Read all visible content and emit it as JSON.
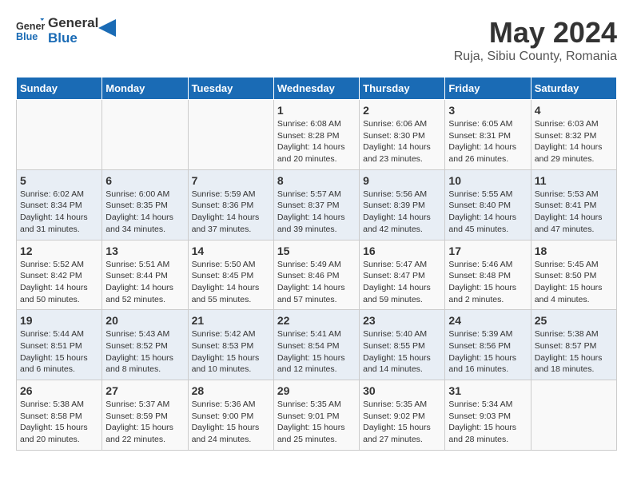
{
  "header": {
    "logo_line1": "General",
    "logo_line2": "Blue",
    "month": "May 2024",
    "location": "Ruja, Sibiu County, Romania"
  },
  "weekdays": [
    "Sunday",
    "Monday",
    "Tuesday",
    "Wednesday",
    "Thursday",
    "Friday",
    "Saturday"
  ],
  "weeks": [
    [
      {
        "day": "",
        "info": ""
      },
      {
        "day": "",
        "info": ""
      },
      {
        "day": "",
        "info": ""
      },
      {
        "day": "1",
        "info": "Sunrise: 6:08 AM\nSunset: 8:28 PM\nDaylight: 14 hours\nand 20 minutes."
      },
      {
        "day": "2",
        "info": "Sunrise: 6:06 AM\nSunset: 8:30 PM\nDaylight: 14 hours\nand 23 minutes."
      },
      {
        "day": "3",
        "info": "Sunrise: 6:05 AM\nSunset: 8:31 PM\nDaylight: 14 hours\nand 26 minutes."
      },
      {
        "day": "4",
        "info": "Sunrise: 6:03 AM\nSunset: 8:32 PM\nDaylight: 14 hours\nand 29 minutes."
      }
    ],
    [
      {
        "day": "5",
        "info": "Sunrise: 6:02 AM\nSunset: 8:34 PM\nDaylight: 14 hours\nand 31 minutes."
      },
      {
        "day": "6",
        "info": "Sunrise: 6:00 AM\nSunset: 8:35 PM\nDaylight: 14 hours\nand 34 minutes."
      },
      {
        "day": "7",
        "info": "Sunrise: 5:59 AM\nSunset: 8:36 PM\nDaylight: 14 hours\nand 37 minutes."
      },
      {
        "day": "8",
        "info": "Sunrise: 5:57 AM\nSunset: 8:37 PM\nDaylight: 14 hours\nand 39 minutes."
      },
      {
        "day": "9",
        "info": "Sunrise: 5:56 AM\nSunset: 8:39 PM\nDaylight: 14 hours\nand 42 minutes."
      },
      {
        "day": "10",
        "info": "Sunrise: 5:55 AM\nSunset: 8:40 PM\nDaylight: 14 hours\nand 45 minutes."
      },
      {
        "day": "11",
        "info": "Sunrise: 5:53 AM\nSunset: 8:41 PM\nDaylight: 14 hours\nand 47 minutes."
      }
    ],
    [
      {
        "day": "12",
        "info": "Sunrise: 5:52 AM\nSunset: 8:42 PM\nDaylight: 14 hours\nand 50 minutes."
      },
      {
        "day": "13",
        "info": "Sunrise: 5:51 AM\nSunset: 8:44 PM\nDaylight: 14 hours\nand 52 minutes."
      },
      {
        "day": "14",
        "info": "Sunrise: 5:50 AM\nSunset: 8:45 PM\nDaylight: 14 hours\nand 55 minutes."
      },
      {
        "day": "15",
        "info": "Sunrise: 5:49 AM\nSunset: 8:46 PM\nDaylight: 14 hours\nand 57 minutes."
      },
      {
        "day": "16",
        "info": "Sunrise: 5:47 AM\nSunset: 8:47 PM\nDaylight: 14 hours\nand 59 minutes."
      },
      {
        "day": "17",
        "info": "Sunrise: 5:46 AM\nSunset: 8:48 PM\nDaylight: 15 hours\nand 2 minutes."
      },
      {
        "day": "18",
        "info": "Sunrise: 5:45 AM\nSunset: 8:50 PM\nDaylight: 15 hours\nand 4 minutes."
      }
    ],
    [
      {
        "day": "19",
        "info": "Sunrise: 5:44 AM\nSunset: 8:51 PM\nDaylight: 15 hours\nand 6 minutes."
      },
      {
        "day": "20",
        "info": "Sunrise: 5:43 AM\nSunset: 8:52 PM\nDaylight: 15 hours\nand 8 minutes."
      },
      {
        "day": "21",
        "info": "Sunrise: 5:42 AM\nSunset: 8:53 PM\nDaylight: 15 hours\nand 10 minutes."
      },
      {
        "day": "22",
        "info": "Sunrise: 5:41 AM\nSunset: 8:54 PM\nDaylight: 15 hours\nand 12 minutes."
      },
      {
        "day": "23",
        "info": "Sunrise: 5:40 AM\nSunset: 8:55 PM\nDaylight: 15 hours\nand 14 minutes."
      },
      {
        "day": "24",
        "info": "Sunrise: 5:39 AM\nSunset: 8:56 PM\nDaylight: 15 hours\nand 16 minutes."
      },
      {
        "day": "25",
        "info": "Sunrise: 5:38 AM\nSunset: 8:57 PM\nDaylight: 15 hours\nand 18 minutes."
      }
    ],
    [
      {
        "day": "26",
        "info": "Sunrise: 5:38 AM\nSunset: 8:58 PM\nDaylight: 15 hours\nand 20 minutes."
      },
      {
        "day": "27",
        "info": "Sunrise: 5:37 AM\nSunset: 8:59 PM\nDaylight: 15 hours\nand 22 minutes."
      },
      {
        "day": "28",
        "info": "Sunrise: 5:36 AM\nSunset: 9:00 PM\nDaylight: 15 hours\nand 24 minutes."
      },
      {
        "day": "29",
        "info": "Sunrise: 5:35 AM\nSunset: 9:01 PM\nDaylight: 15 hours\nand 25 minutes."
      },
      {
        "day": "30",
        "info": "Sunrise: 5:35 AM\nSunset: 9:02 PM\nDaylight: 15 hours\nand 27 minutes."
      },
      {
        "day": "31",
        "info": "Sunrise: 5:34 AM\nSunset: 9:03 PM\nDaylight: 15 hours\nand 28 minutes."
      },
      {
        "day": "",
        "info": ""
      }
    ]
  ]
}
